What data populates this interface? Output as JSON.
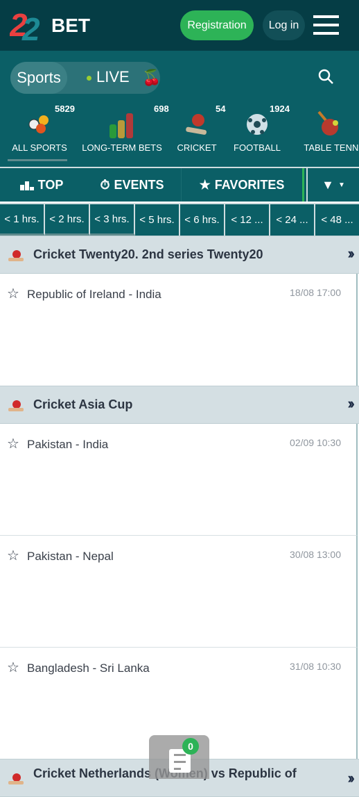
{
  "header": {
    "logo_text": "22BET",
    "registration": "Registration",
    "login": "Log in"
  },
  "nav": {
    "sports": "Sports",
    "live": "LIVE",
    "categories": [
      {
        "label": "ALL SPORTS",
        "count": "5829",
        "icon": "all-sports-icon"
      },
      {
        "label": "LONG-TERM BETS",
        "count": "698",
        "icon": "long-term-bets-icon"
      },
      {
        "label": "CRICKET",
        "count": "54",
        "icon": "cricket-icon"
      },
      {
        "label": "FOOTBALL",
        "count": "1924",
        "icon": "football-icon"
      },
      {
        "label": "TABLE TENNIS",
        "count": "",
        "icon": "table-tennis-icon"
      }
    ]
  },
  "tabs": {
    "top": "TOP",
    "events": "EVENTS",
    "favorites": "FAVORITES"
  },
  "time_filters": [
    "< 1 hrs.",
    "< 2 hrs.",
    "< 3 hrs.",
    "< 5 hrs.",
    "< 6 hrs.",
    "< 12 ...",
    "< 24 ...",
    "< 48 ..."
  ],
  "sections": [
    {
      "title": "Cricket Twenty20. 2nd series Twenty20",
      "events": [
        {
          "name": "Republic of Ireland - India",
          "date": "18/08 17:00"
        }
      ]
    },
    {
      "title": "Cricket Asia Cup",
      "events": [
        {
          "name": "Pakistan - India",
          "date": "02/09 10:30"
        },
        {
          "name": "Pakistan - Nepal",
          "date": "30/08 13:00"
        },
        {
          "name": "Bangladesh - Sri Lanka",
          "date": "31/08 10:30"
        }
      ]
    },
    {
      "title": "Cricket Netherlands (Women) vs Republic of",
      "events": []
    }
  ],
  "bet_slip": {
    "count": "0"
  },
  "colors": {
    "header": "#053d45",
    "nav": "#0b5f66",
    "accent": "#2db357",
    "section": "#d4dfe3"
  }
}
